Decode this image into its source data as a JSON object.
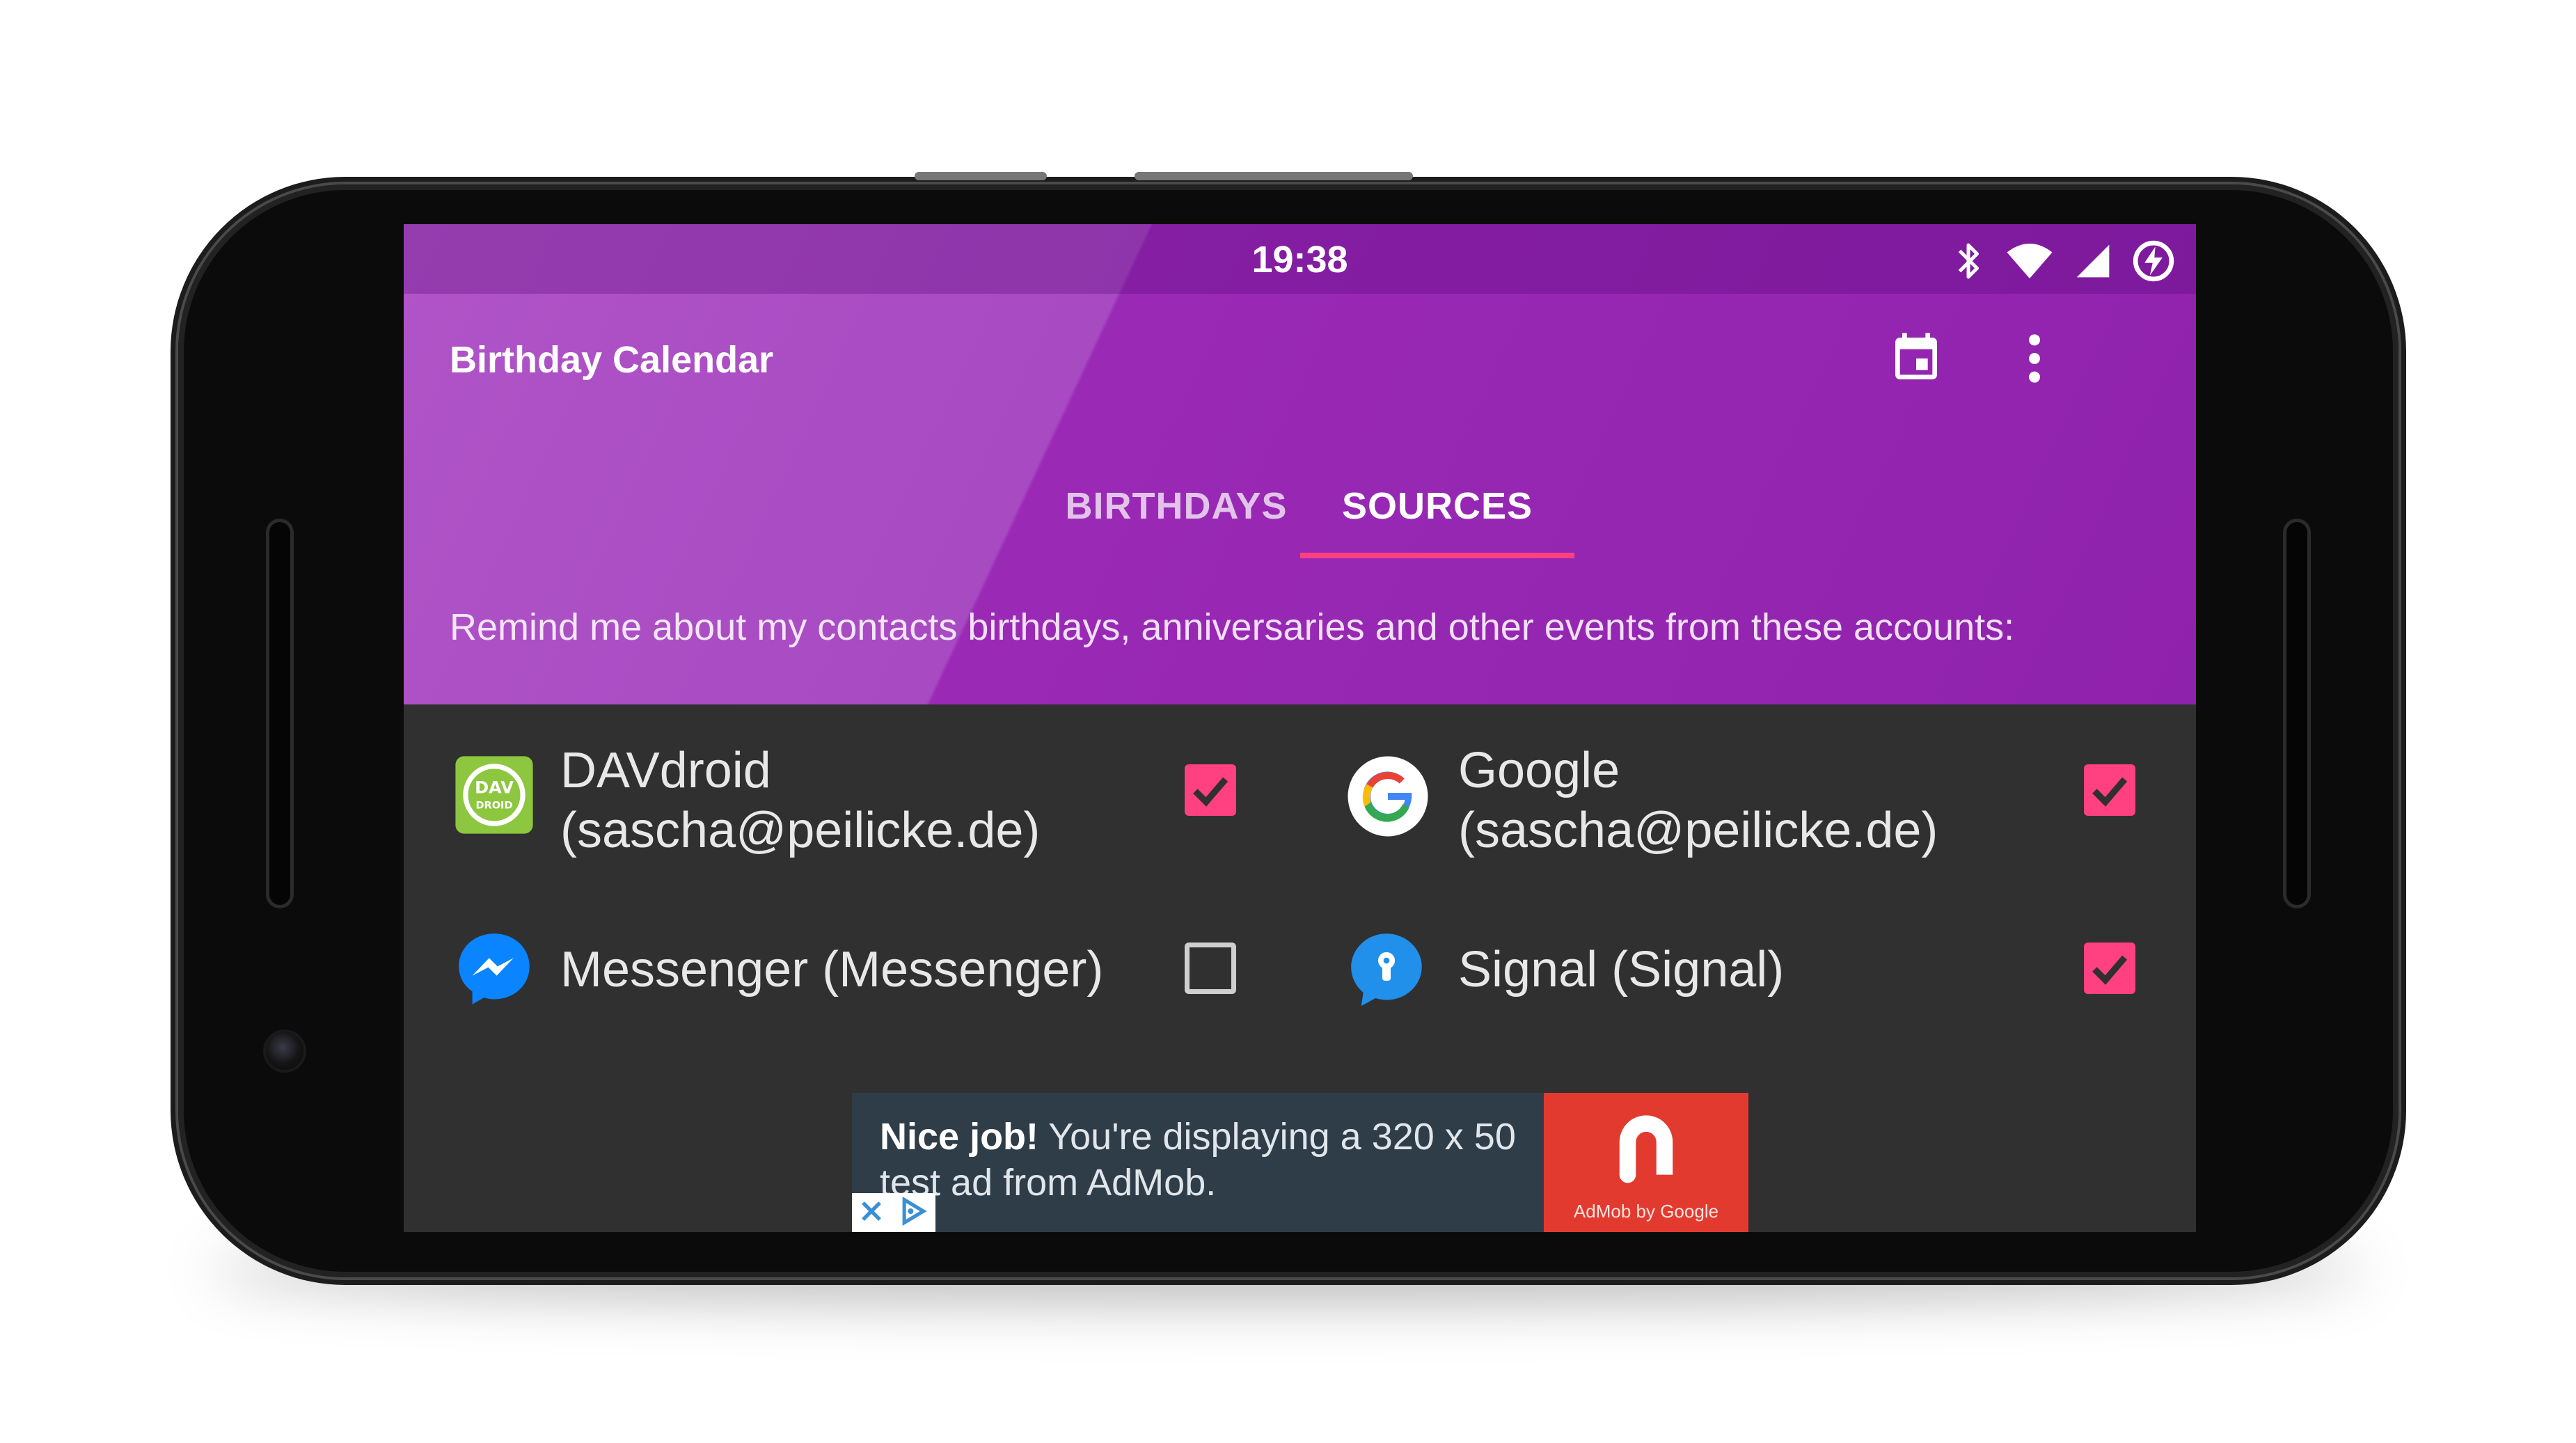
{
  "status_bar": {
    "time": "19:38",
    "icons": [
      "bluetooth-icon",
      "wifi-icon",
      "signal-icon",
      "battery-charging-icon"
    ]
  },
  "app_bar": {
    "title": "Birthday Calendar",
    "actions": [
      "calendar-icon",
      "more-vert-icon"
    ]
  },
  "tabs": [
    {
      "label": "BIRTHDAYS",
      "active": false
    },
    {
      "label": "SOURCES",
      "active": true
    }
  ],
  "description": "Remind me about my contacts birthdays, anniversaries and other events from these accounts:",
  "sources": [
    {
      "line1": "DAVdroid",
      "line2": "(sascha@peilicke.de)",
      "icon": "davdroid-icon",
      "icon_text": "DAV DROID",
      "checked": true
    },
    {
      "line1": "Google",
      "line2": "(sascha@peilicke.de)",
      "icon": "google-icon",
      "checked": true
    },
    {
      "line1": "Messenger (Messenger)",
      "line2": "",
      "icon": "messenger-icon",
      "checked": false
    },
    {
      "line1": "Signal (Signal)",
      "line2": "",
      "icon": "signal-app-icon",
      "checked": true
    }
  ],
  "ad": {
    "headline": "Nice job!",
    "body": "You're displaying a 320 x 50 test ad from AdMob.",
    "logo_caption": "AdMob by Google"
  },
  "colors": {
    "primary": "#9c27b0",
    "accent": "#ff4081",
    "background": "#303030"
  }
}
